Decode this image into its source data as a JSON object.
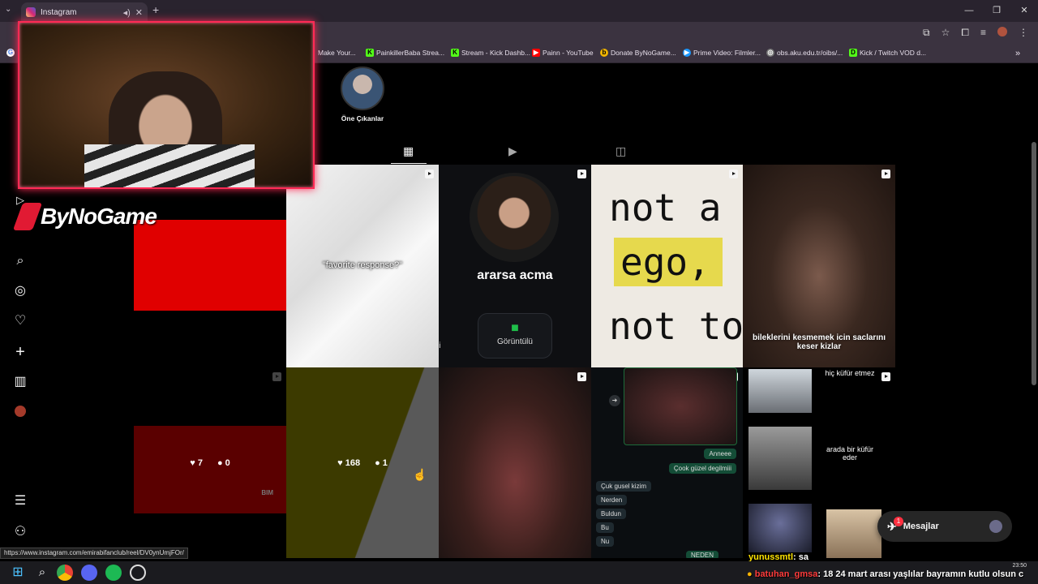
{
  "browser": {
    "tab_title": "Instagram",
    "bookmarks": [
      {
        "label": "Make Your...",
        "icon": "bookmark-icon"
      },
      {
        "label": "PainkillerBaba Strea...",
        "icon": "kick-icon"
      },
      {
        "label": "Stream - Kick Dashb...",
        "icon": "kick-icon"
      },
      {
        "label": "Painn - YouTube",
        "icon": "youtube-icon"
      },
      {
        "label": "Donate ByNoGame...",
        "icon": "bynogame-icon"
      },
      {
        "label": "Prime Video: Filmler...",
        "icon": "prime-icon"
      },
      {
        "label": "obs.aku.edu.tr/oibs/...",
        "icon": "globe-icon"
      },
      {
        "label": "Kick / Twitch VOD d...",
        "icon": "kick-icon"
      }
    ],
    "status_url": "https://www.instagram.com/emirabifanclub/reel/DV0ynUmjFOr/"
  },
  "profile": {
    "highlight_label": "Öne Çıkanlar"
  },
  "tiles": {
    "t2_caption": "\"favorite response?\"",
    "t3_caption": "ararsa acma",
    "t3_button": "Görüntülü",
    "t3_left": "li",
    "t4_line1": "not a",
    "t4_word": "ego,",
    "t4_line3": "not to",
    "t5_caption": "bileklerini kesmemek icin saclarını keser kizlar",
    "t6_likes": "7",
    "t6_comments": "0",
    "t6_mark": "BIM",
    "t7_likes": "168",
    "t7_comments": "1",
    "t9_msgs": [
      "Anneee",
      "Çook güzel degilmiii",
      "Çuk gusel kizim",
      "Nerden",
      "Buldun",
      "Bu",
      "Nu",
      "NEDEN"
    ],
    "t10_a": "hiç küfür etmez",
    "t10_b": "arada bir küfür eder"
  },
  "messages": {
    "label": "Mesajlar",
    "badge": "1"
  },
  "overlay": {
    "brand": "ByNoGame"
  },
  "chat": {
    "line1_user": "yunussmtl",
    "line1_text": ": sa",
    "line2_user": "batuhan_gmsa",
    "line2_text": ": 18 24 mart arası yaşlılar bayramın kutlu olsun c"
  },
  "taskbar": {
    "time": "23:50"
  },
  "colors": {
    "accent": "#ff2a55",
    "brand_red": "#e11a33",
    "chat_user1": "#ffe400",
    "chat_user2": "#ff3b3b"
  }
}
